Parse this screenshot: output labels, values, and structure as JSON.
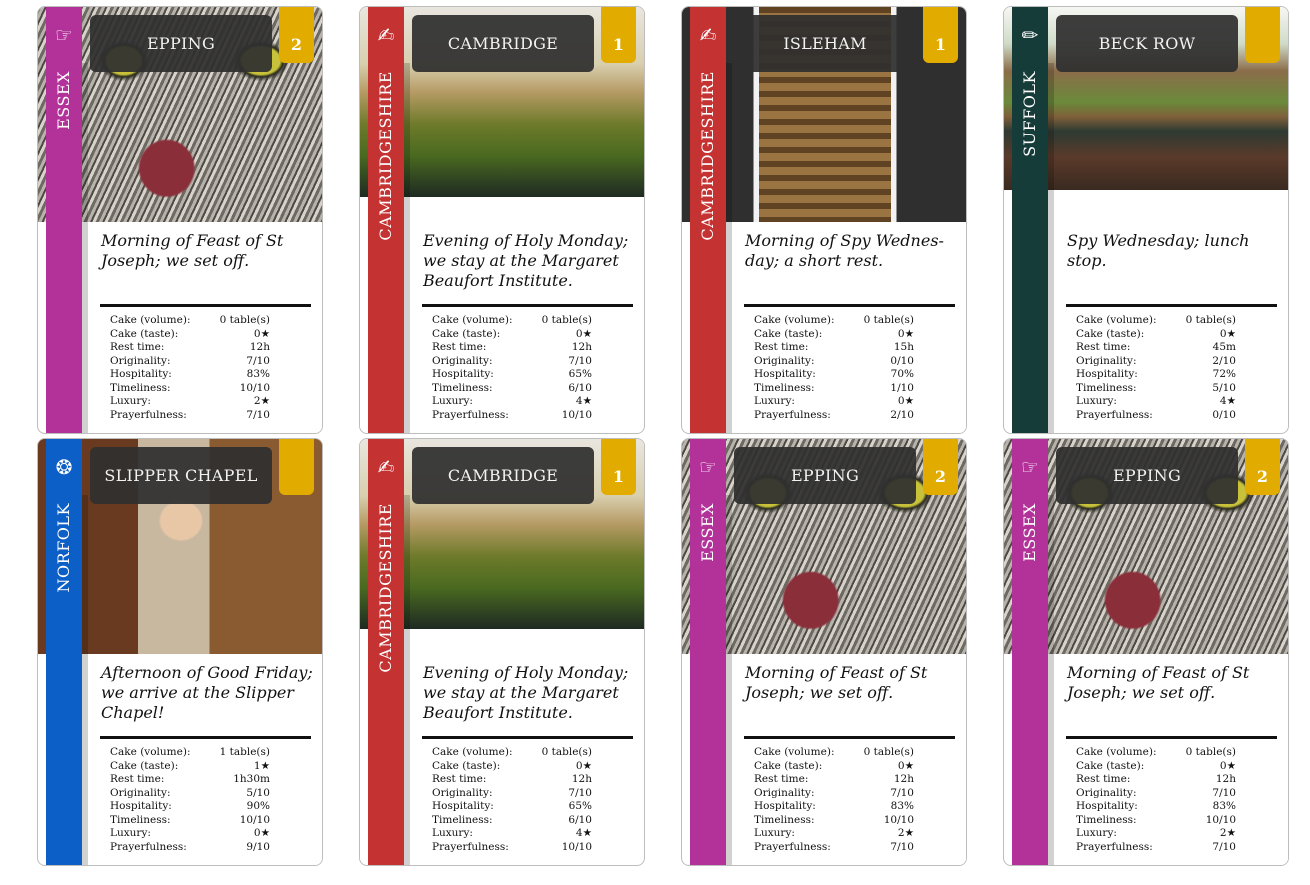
{
  "stat_labels": [
    "Cake (volume):",
    "Cake (taste):",
    "Rest time:",
    "Originality:",
    "Hospitality:",
    "Timeliness:",
    "Luxury:",
    "Prayerfulness:"
  ],
  "colors": {
    "essex": "#b2329a",
    "cambs": "#c43232",
    "suffolk": "#163c3a",
    "norfolk": "#0b5fc6",
    "number_tab": "#e1ab00",
    "header_bg": "#2f2f2f"
  },
  "cards": [
    {
      "title": "EPPING",
      "number": "2",
      "region": "ESSEX",
      "icon": "☞",
      "icon_name": "pointing-hand-icon",
      "description": "Morning of Feast of St Joseph; we set off.",
      "stats": [
        "0 table(s)",
        "0★",
        "12h",
        "7/10",
        "83%",
        "10/10",
        "2★",
        "7/10"
      ]
    },
    {
      "title": "CAMBRIDGE",
      "number": "1",
      "region": "CAMBRIDGESHIRE",
      "icon": "✍",
      "icon_name": "writing-hand-icon",
      "description": "Evening of Holy Monday; we stay at the Margaret Beaufort Institute.",
      "stats": [
        "0 table(s)",
        "0★",
        "12h",
        "7/10",
        "65%",
        "6/10",
        "4★",
        "10/10"
      ]
    },
    {
      "title": "ISLEHAM",
      "number": "1",
      "region": "CAMBRIDGESHIRE",
      "icon": "✍",
      "icon_name": "writing-hand-icon",
      "description": "Morning of Spy Wednes-day; a short rest.",
      "stats": [
        "0 table(s)",
        "0★",
        "15h",
        "0/10",
        "70%",
        "1/10",
        "0★",
        "2/10"
      ]
    },
    {
      "title": "BECK ROW",
      "number": "",
      "region": "SUFFOLK",
      "icon": "✏",
      "icon_name": "pencil-icon",
      "description": "Spy Wednesday; lunch stop.",
      "stats": [
        "0 table(s)",
        "0★",
        "45m",
        "2/10",
        "72%",
        "5/10",
        "4★",
        "0/10"
      ]
    },
    {
      "title": "SLIPPER CHAPEL",
      "number": "",
      "region": "NORFOLK",
      "icon": "❂",
      "icon_name": "flower-icon",
      "description": "Afternoon of Good Friday; we arrive at the Slipper Chapel!",
      "stats": [
        "1 table(s)",
        "1★",
        "1h30m",
        "5/10",
        "90%",
        "10/10",
        "0★",
        "9/10"
      ]
    },
    {
      "title": "CAMBRIDGE",
      "number": "1",
      "region": "CAMBRIDGESHIRE",
      "icon": "✍",
      "icon_name": "writing-hand-icon",
      "description": "Evening of Holy Monday; we stay at the Margaret Beaufort Institute.",
      "stats": [
        "0 table(s)",
        "0★",
        "12h",
        "7/10",
        "65%",
        "6/10",
        "4★",
        "10/10"
      ]
    },
    {
      "title": "EPPING",
      "number": "2",
      "region": "ESSEX",
      "icon": "☞",
      "icon_name": "pointing-hand-icon",
      "description": "Morning of Feast of St Joseph; we set off.",
      "stats": [
        "0 table(s)",
        "0★",
        "12h",
        "7/10",
        "83%",
        "10/10",
        "2★",
        "7/10"
      ]
    },
    {
      "title": "EPPING",
      "number": "2",
      "region": "ESSEX",
      "icon": "☞",
      "icon_name": "pointing-hand-icon",
      "description": "Morning of Feast of St Joseph; we set off.",
      "stats": [
        "0 table(s)",
        "0★",
        "12h",
        "7/10",
        "83%",
        "10/10",
        "2★",
        "7/10"
      ]
    }
  ]
}
